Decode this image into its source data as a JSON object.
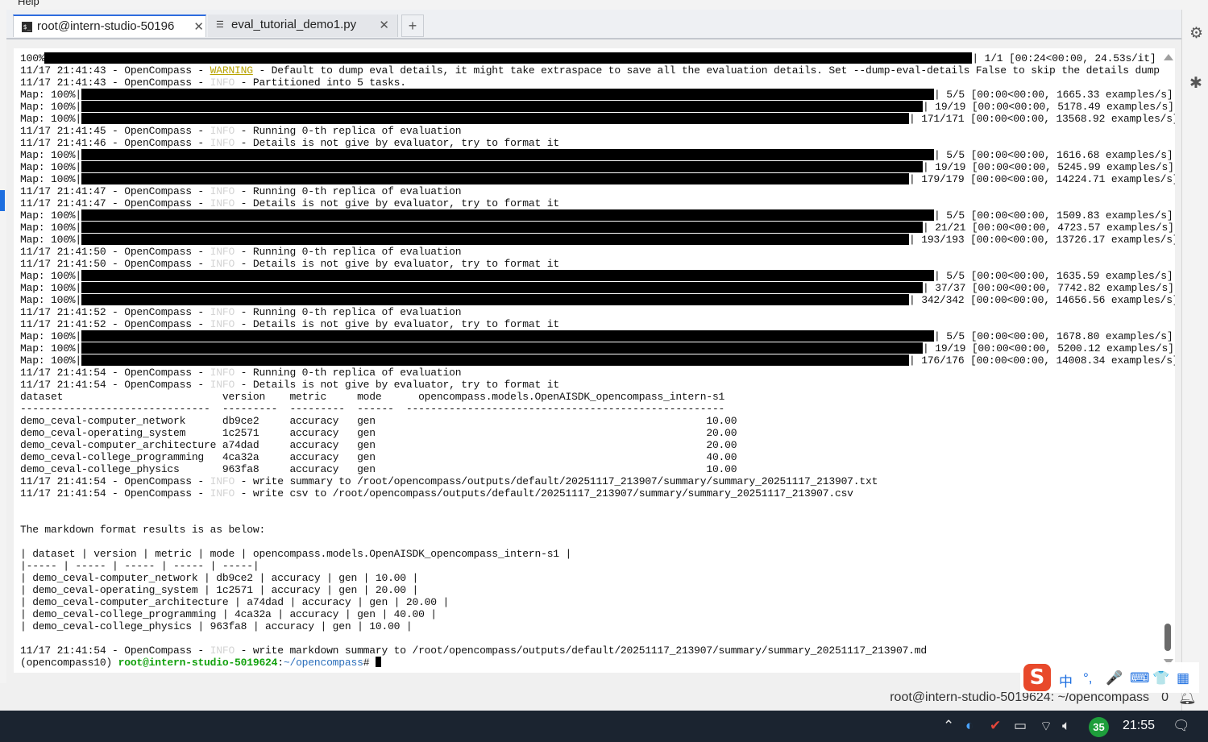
{
  "menu": {
    "help": "Help"
  },
  "tabs": [
    {
      "label": "root@intern-studio-50196",
      "close": "✕",
      "icon": "terminal-icon"
    },
    {
      "label": "eval_tutorial_demo1.py",
      "close": "✕",
      "icon": "file-text-icon"
    }
  ],
  "tab_add": "+",
  "terminal": {
    "progress": {
      "prefix": "100%",
      "suffix": "| 1/1 [00:24<00:00, 24.53s/it]"
    },
    "log_warning": {
      "prefix": "11/17 21:41:43 - OpenCompass - ",
      "level": "WARNING",
      "message": " - Default to dump eval details, it might take extraspace to save all the evaluation details. Set --dump-eval-details False to skip the details dump"
    },
    "log_partition": {
      "prefix": "11/17 21:41:43 - OpenCompass - ",
      "level": "INFO",
      "message": " - Partitioned into 5 tasks."
    },
    "blocks": [
      {
        "maps": [
          {
            "label": "Map: 100%|",
            "suffix": "| 5/5 [00:00<00:00, 1665.33 examples/s]"
          },
          {
            "label": "Map: 100%|",
            "suffix": "| 19/19 [00:00<00:00, 5178.49 examples/s]"
          },
          {
            "label": "Map: 100%|",
            "suffix": "| 171/171 [00:00<00:00, 13568.92 examples/s]"
          }
        ],
        "logs": [
          {
            "prefix": "11/17 21:41:45 - OpenCompass - ",
            "level": "INFO",
            "message": " - Running 0-th replica of evaluation"
          },
          {
            "prefix": "11/17 21:41:46 - OpenCompass - ",
            "level": "INFO",
            "message": " - Details is not give by evaluator, try to format it"
          }
        ]
      },
      {
        "maps": [
          {
            "label": "Map: 100%|",
            "suffix": "| 5/5 [00:00<00:00, 1616.68 examples/s]"
          },
          {
            "label": "Map: 100%|",
            "suffix": "| 19/19 [00:00<00:00, 5245.99 examples/s]"
          },
          {
            "label": "Map: 100%|",
            "suffix": "| 179/179 [00:00<00:00, 14224.71 examples/s]"
          }
        ],
        "logs": [
          {
            "prefix": "11/17 21:41:47 - OpenCompass - ",
            "level": "INFO",
            "message": " - Running 0-th replica of evaluation"
          },
          {
            "prefix": "11/17 21:41:47 - OpenCompass - ",
            "level": "INFO",
            "message": " - Details is not give by evaluator, try to format it"
          }
        ]
      },
      {
        "maps": [
          {
            "label": "Map: 100%|",
            "suffix": "| 5/5 [00:00<00:00, 1509.83 examples/s]"
          },
          {
            "label": "Map: 100%|",
            "suffix": "| 21/21 [00:00<00:00, 4723.57 examples/s]"
          },
          {
            "label": "Map: 100%|",
            "suffix": "| 193/193 [00:00<00:00, 13726.17 examples/s]"
          }
        ],
        "logs": [
          {
            "prefix": "11/17 21:41:50 - OpenCompass - ",
            "level": "INFO",
            "message": " - Running 0-th replica of evaluation"
          },
          {
            "prefix": "11/17 21:41:50 - OpenCompass - ",
            "level": "INFO",
            "message": " - Details is not give by evaluator, try to format it"
          }
        ]
      },
      {
        "maps": [
          {
            "label": "Map: 100%|",
            "suffix": "| 5/5 [00:00<00:00, 1635.59 examples/s]"
          },
          {
            "label": "Map: 100%|",
            "suffix": "| 37/37 [00:00<00:00, 7742.82 examples/s]"
          },
          {
            "label": "Map: 100%|",
            "suffix": "| 342/342 [00:00<00:00, 14656.56 examples/s]"
          }
        ],
        "logs": [
          {
            "prefix": "11/17 21:41:52 - OpenCompass - ",
            "level": "INFO",
            "message": " - Running 0-th replica of evaluation"
          },
          {
            "prefix": "11/17 21:41:52 - OpenCompass - ",
            "level": "INFO",
            "message": " - Details is not give by evaluator, try to format it"
          }
        ]
      },
      {
        "maps": [
          {
            "label": "Map: 100%|",
            "suffix": "| 5/5 [00:00<00:00, 1678.80 examples/s]"
          },
          {
            "label": "Map: 100%|",
            "suffix": "| 19/19 [00:00<00:00, 5200.12 examples/s]"
          },
          {
            "label": "Map: 100%|",
            "suffix": "| 176/176 [00:00<00:00, 14008.34 examples/s]"
          }
        ],
        "logs": [
          {
            "prefix": "11/17 21:41:54 - OpenCompass - ",
            "level": "INFO",
            "message": " - Running 0-th replica of evaluation"
          },
          {
            "prefix": "11/17 21:41:54 - OpenCompass - ",
            "level": "INFO",
            "message": " - Details is not give by evaluator, try to format it"
          }
        ]
      }
    ],
    "results_table": {
      "header": "dataset                          version    metric     mode      opencompass.models.OpenAISDK_opencompass_intern-s1",
      "separator": "-------------------------------  ---------  ---------  ------  ----------------------------------------------------",
      "rows": [
        "demo_ceval-computer_network      db9ce2     accuracy   gen                                                      10.00",
        "demo_ceval-operating_system      1c2571     accuracy   gen                                                      20.00",
        "demo_ceval-computer_architecture a74dad     accuracy   gen                                                      20.00",
        "demo_ceval-college_programming   4ca32a     accuracy   gen                                                      40.00",
        "demo_ceval-college_physics       963fa8     accuracy   gen                                                      10.00"
      ]
    },
    "write_logs": [
      {
        "prefix": "11/17 21:41:54 - OpenCompass - ",
        "level": "INFO",
        "message": " - write summary to /root/opencompass/outputs/default/20251117_213907/summary/summary_20251117_213907.txt"
      },
      {
        "prefix": "11/17 21:41:54 - OpenCompass - ",
        "level": "INFO",
        "message": " - write csv to /root/opencompass/outputs/default/20251117_213907/summary/summary_20251117_213907.csv"
      }
    ],
    "markdown_intro": "The markdown format results is as below:",
    "markdown_lines": [
      "| dataset | version | metric | mode | opencompass.models.OpenAISDK_opencompass_intern-s1 |",
      "|----- | ----- | ----- | ----- | -----|",
      "| demo_ceval-computer_network | db9ce2 | accuracy | gen | 10.00 |",
      "| demo_ceval-operating_system | 1c2571 | accuracy | gen | 20.00 |",
      "| demo_ceval-computer_architecture | a74dad | accuracy | gen | 20.00 |",
      "| demo_ceval-college_programming | 4ca32a | accuracy | gen | 40.00 |",
      "| demo_ceval-college_physics | 963fa8 | accuracy | gen | 10.00 |"
    ],
    "final_log": {
      "prefix": "11/17 21:41:54 - OpenCompass - ",
      "level": "INFO",
      "message": " - write markdown summary to /root/opencompass/outputs/default/20251117_213907/summary/summary_20251117_213907.md"
    },
    "prompt": {
      "env": "(opencompass10) ",
      "user_host": "root@intern-studio-5019624",
      "colon": ":",
      "path": "~/opencompass",
      "symbol": "# "
    }
  },
  "statusbar": {
    "text": "root@intern-studio-5019624: ~/opencompass",
    "count": "0"
  },
  "ime": {
    "logo": "S",
    "lang": "中",
    "punct": "°,",
    "mic": "🎤",
    "keyboard": "⌨",
    "skin": "👕",
    "apps": "▦"
  },
  "taskbar": {
    "badge": "35",
    "clock": "21:55"
  },
  "colors": {
    "accent": "#2d6cdf",
    "warning": "#b8a300",
    "prompt_user": "#13a10e",
    "prompt_path": "#2c6fbb"
  },
  "icons": [
    "terminal-icon",
    "file-text-icon",
    "gears-icon",
    "bug-icon",
    "bell-icon",
    "chevron-up-icon",
    "wifi-icon",
    "volume-icon",
    "battery-icon",
    "notification-icon"
  ]
}
